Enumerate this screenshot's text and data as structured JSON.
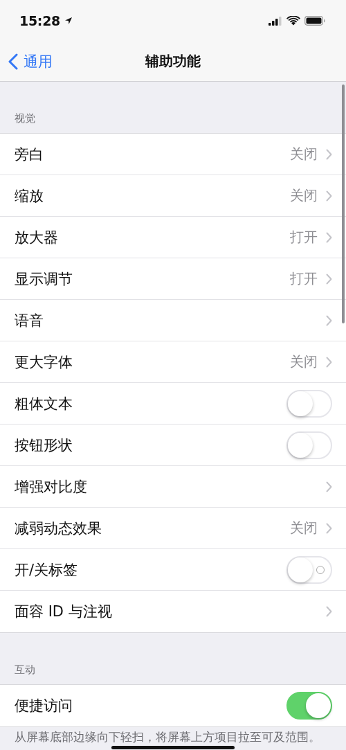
{
  "status_bar": {
    "time": "15:28"
  },
  "nav": {
    "back": "通用",
    "title": "辅助功能"
  },
  "sections": [
    {
      "header": "视觉",
      "rows": [
        {
          "kind": "link",
          "label": "旁白",
          "value": "关闭"
        },
        {
          "kind": "link",
          "label": "缩放",
          "value": "关闭"
        },
        {
          "kind": "link",
          "label": "放大器",
          "value": "打开"
        },
        {
          "kind": "link",
          "label": "显示调节",
          "value": "打开"
        },
        {
          "kind": "link",
          "label": "语音"
        },
        {
          "kind": "link",
          "label": "更大字体",
          "value": "关闭"
        },
        {
          "kind": "toggle",
          "label": "粗体文本",
          "on": false
        },
        {
          "kind": "toggle",
          "label": "按钮形状",
          "on": false
        },
        {
          "kind": "link",
          "label": "增强对比度"
        },
        {
          "kind": "link",
          "label": "减弱动态效果",
          "value": "关闭"
        },
        {
          "kind": "labeled-toggle",
          "label": "开/关标签",
          "on": false
        },
        {
          "kind": "link",
          "label": "面容 ID 与注视"
        }
      ]
    },
    {
      "header": "互动",
      "rows": [
        {
          "kind": "toggle",
          "label": "便捷访问",
          "on": true
        }
      ],
      "footer": "从屏幕底部边缘向下轻扫，将屏幕上方项目拉至可及范围。"
    }
  ]
}
